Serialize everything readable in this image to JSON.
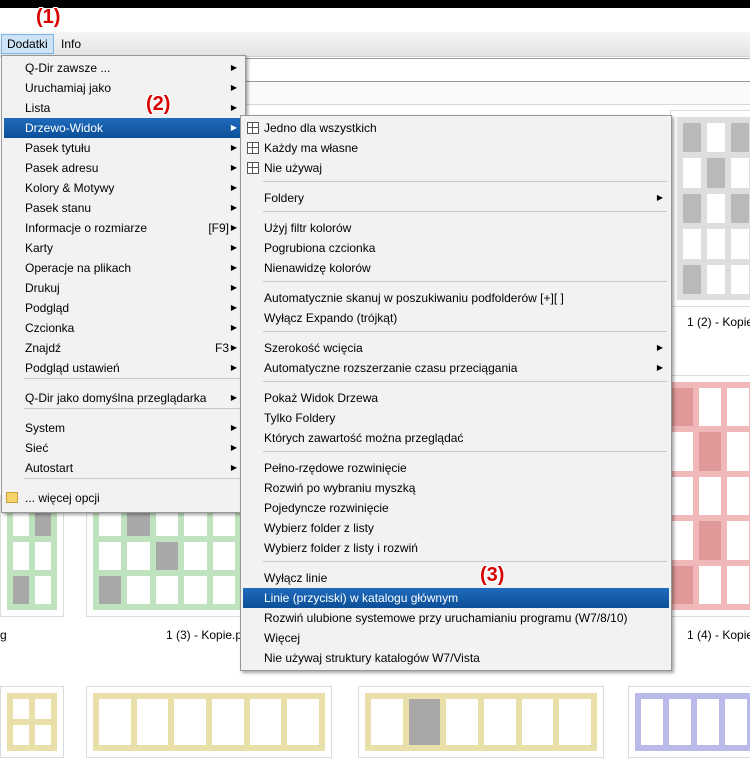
{
  "menubar": {
    "dodatki": "Dodatki",
    "info": "Info"
  },
  "annotations": {
    "a1": "(1)",
    "a2": "(2)",
    "a3": "(3)"
  },
  "captions": {
    "c1": "1 (2) - Kopie",
    "c2": "1 (3) - Kopie.p",
    "c3": "1 (4) - Kopie",
    "c4": "g"
  },
  "menu1": {
    "items": [
      {
        "label": "Q-Dir zawsze ...",
        "sc": "",
        "sub": true
      },
      {
        "label": "Uruchamiaj jako",
        "sc": "",
        "sub": true
      },
      {
        "label": "Lista",
        "sc": "",
        "sub": true
      },
      {
        "label": "Drzewo-Widok",
        "sc": "",
        "sub": true
      },
      {
        "label": "Pasek tytułu",
        "sc": "",
        "sub": true
      },
      {
        "label": "Pasek adresu",
        "sc": "",
        "sub": true
      },
      {
        "label": "Kolory & Motywy",
        "sc": "",
        "sub": true
      },
      {
        "label": "Pasek stanu",
        "sc": "",
        "sub": true
      },
      {
        "label": "Informacje o rozmiarze",
        "sc": "[F9]",
        "sub": true
      },
      {
        "label": "Karty",
        "sc": "",
        "sub": true
      },
      {
        "label": "Operacje na plikach",
        "sc": "",
        "sub": true
      },
      {
        "label": "Drukuj",
        "sc": "",
        "sub": true
      },
      {
        "label": "Podgląd",
        "sc": "",
        "sub": true
      },
      {
        "label": "Czcionka",
        "sc": "",
        "sub": true
      },
      {
        "label": "Znajdź",
        "sc": "F3",
        "sub": true
      },
      {
        "label": "Podgląd ustawień",
        "sc": "",
        "sub": true
      },
      {
        "label": "Q-Dir jako domyślna przeglądarka",
        "sc": "",
        "sub": true
      },
      {
        "label": "System",
        "sc": "",
        "sub": true
      },
      {
        "label": "Sieć",
        "sc": "",
        "sub": true
      },
      {
        "label": "Autostart",
        "sc": "",
        "sub": true
      },
      {
        "label": "... więcej opcji",
        "sc": "",
        "sub": false
      }
    ]
  },
  "menu2": {
    "items": [
      {
        "label": "Jedno dla wszystkich",
        "sub": false
      },
      {
        "label": "Każdy ma własne",
        "sub": false
      },
      {
        "label": "Nie używaj",
        "sub": false
      },
      {
        "label": "Foldery",
        "sub": true
      },
      {
        "label": "Użyj filtr kolorów",
        "sub": false
      },
      {
        "label": "Pogrubiona czcionka",
        "sub": false
      },
      {
        "label": "Nienawidzę kolorów",
        "sub": false
      },
      {
        "label": "Automatycznie skanuj w poszukiwaniu podfolderów [+][ ]",
        "sub": false
      },
      {
        "label": "Wyłącz Expando (trójkąt)",
        "sub": false
      },
      {
        "label": "Szerokość wcięcia",
        "sub": true
      },
      {
        "label": "Automatyczne rozszerzanie czasu przeciągania",
        "sub": true
      },
      {
        "label": "Pokaż Widok Drzewa",
        "sub": false
      },
      {
        "label": "Tylko Foldery",
        "sub": false
      },
      {
        "label": "Których zawartość można przeglądać",
        "sub": false
      },
      {
        "label": "Pełno-rzędowe rozwinięcie",
        "sub": false
      },
      {
        "label": "Rozwiń po wybraniu myszką",
        "sub": false
      },
      {
        "label": "Pojedyncze rozwinięcie",
        "sub": false
      },
      {
        "label": "Wybierz folder z listy",
        "sub": false
      },
      {
        "label": "Wybierz folder z listy i rozwiń",
        "sub": false
      },
      {
        "label": "Wyłącz linie",
        "sub": false
      },
      {
        "label": "Linie (przyciski) w katalogu głównym",
        "sub": false
      },
      {
        "label": "Rozwiń ulubione systemowe przy uruchamianiu programu (W7/8/10)",
        "sub": false
      },
      {
        "label": "Więcej",
        "sub": false
      },
      {
        "label": "Nie używaj struktury katalogów W7/Vista",
        "sub": false
      }
    ]
  },
  "arrow": "▶"
}
